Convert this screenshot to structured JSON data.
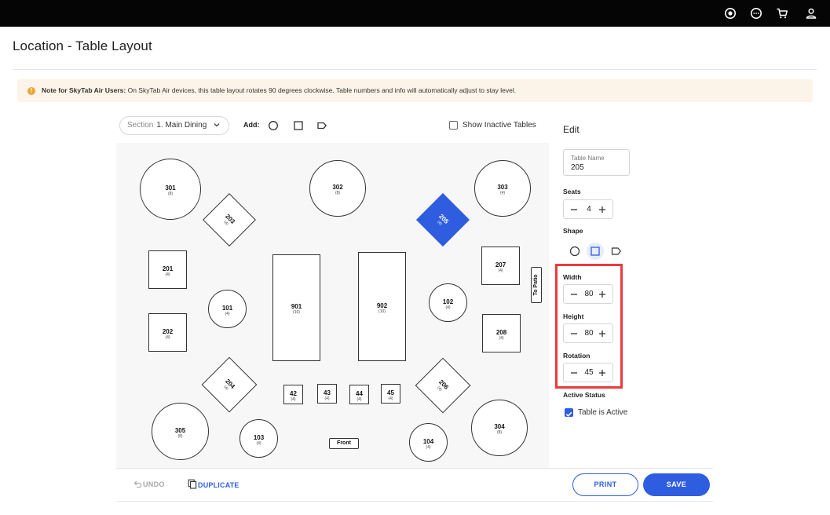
{
  "header": {
    "icons": [
      "record-icon",
      "chat-icon",
      "cart-icon",
      "user-icon"
    ]
  },
  "page": {
    "title": "Location - Table Layout"
  },
  "note": {
    "bold": "Note for SkyTab Air Users:",
    "text": " On SkyTab Air devices, this table layout rotates 90 degrees clockwise. Table numbers and info will automatically adjust to stay level."
  },
  "toolbar": {
    "section_label": "Section",
    "section_value": "1. Main Dining",
    "add_label": "Add:",
    "show_inactive_label": "Show Inactive Tables",
    "show_inactive_checked": false
  },
  "tables": [
    {
      "number": "301",
      "seats": "(8)",
      "shape": "circle"
    },
    {
      "number": "302",
      "seats": "(8)",
      "shape": "circle"
    },
    {
      "number": "303",
      "seats": "(4)",
      "shape": "circle"
    },
    {
      "number": "203",
      "seats": "(4)",
      "shape": "diamond"
    },
    {
      "number": "205",
      "seats": "(4)",
      "shape": "diamond",
      "selected": true
    },
    {
      "number": "201",
      "seats": "(4)",
      "shape": "square"
    },
    {
      "number": "202",
      "seats": "(4)",
      "shape": "square"
    },
    {
      "number": "101",
      "seats": "(4)",
      "shape": "circle"
    },
    {
      "number": "901",
      "seats": "(10)",
      "shape": "rectangle"
    },
    {
      "number": "902",
      "seats": "(10)",
      "shape": "rectangle"
    },
    {
      "number": "102",
      "seats": "(4)",
      "shape": "circle"
    },
    {
      "number": "207",
      "seats": "(4)",
      "shape": "square"
    },
    {
      "number": "208",
      "seats": "(4)",
      "shape": "square"
    },
    {
      "number": "204",
      "seats": "(4)",
      "shape": "diamond"
    },
    {
      "number": "206",
      "seats": "(4)",
      "shape": "diamond"
    },
    {
      "number": "42",
      "seats": "(4)",
      "shape": "square"
    },
    {
      "number": "43",
      "seats": "(4)",
      "shape": "square"
    },
    {
      "number": "44",
      "seats": "(4)",
      "shape": "square"
    },
    {
      "number": "45",
      "seats": "(4)",
      "shape": "square"
    },
    {
      "number": "305",
      "seats": "(8)",
      "shape": "circle"
    },
    {
      "number": "103",
      "seats": "(4)",
      "shape": "circle"
    },
    {
      "number": "104",
      "seats": "(4)",
      "shape": "circle"
    },
    {
      "number": "304",
      "seats": "(8)",
      "shape": "circle"
    }
  ],
  "labels": {
    "front": "Front",
    "to_patio": "To Patio"
  },
  "bottom": {
    "undo": "UNDO",
    "duplicate": "DUPLICATE",
    "print": "PRINT",
    "save": "SAVE"
  },
  "edit": {
    "title": "Edit",
    "table_name_label": "Table Name",
    "table_name_value": "205",
    "seats_label": "Seats",
    "seats_value": "4",
    "shape_label": "Shape",
    "selected_shape": "square",
    "width_label": "Width",
    "width_value": "80",
    "height_label": "Height",
    "height_value": "80",
    "rotation_label": "Rotation",
    "rotation_value": "45",
    "active_status_label": "Active Status",
    "active_label": "Table is Active",
    "active_checked": true
  },
  "colors": {
    "accent": "#2f5de0",
    "highlight": "#ea3b3b",
    "note_bg": "#fdf4e9",
    "note_icon": "#f0a23a"
  }
}
